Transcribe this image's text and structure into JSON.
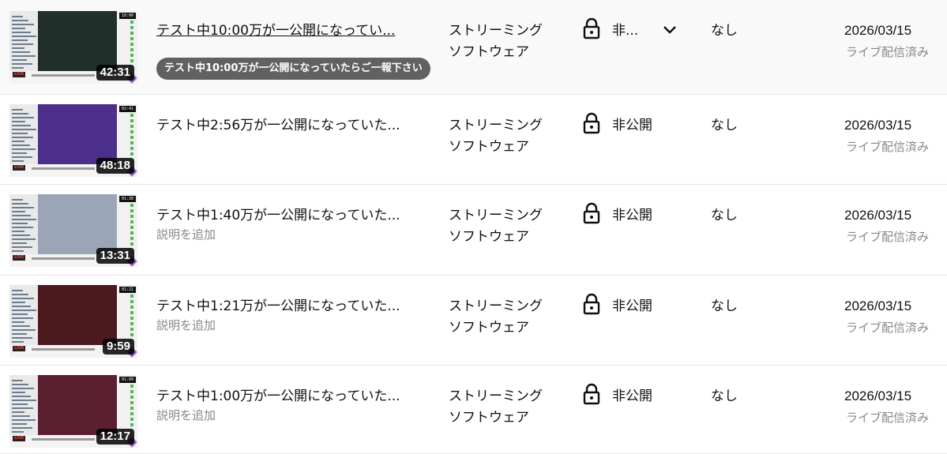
{
  "colors": {
    "row_hover_bg": "#f9f9f9",
    "secondary_text": "#888888",
    "tooltip_bg": "#616161"
  },
  "tooltip": {
    "text": "テスト中10:00万が一公開になっていたらご一報下さい"
  },
  "rows": [
    {
      "thumbnail": {
        "duration": "42:31",
        "top_badge": "10:00",
        "live_tag": "LIVE",
        "scene_color": "#22302c"
      },
      "title": "テスト中10:00万が一公開になってい...",
      "description": "",
      "type_line1": "ストリーミング",
      "type_line2": "ソフトウェア",
      "visibility": "非...",
      "visibility_icon": "lock-icon",
      "restrictions": "なし",
      "date": "2026/03/15",
      "date_status": "ライブ配信済み",
      "hovered": true
    },
    {
      "thumbnail": {
        "duration": "48:18",
        "top_badge": "02:41",
        "live_tag": "LIVE",
        "scene_color": "#4b2f8a"
      },
      "title": "テスト中2:56万が一公開になっていた...",
      "description": "",
      "type_line1": "ストリーミング",
      "type_line2": "ソフトウェア",
      "visibility": "非公開",
      "visibility_icon": "lock-icon",
      "restrictions": "なし",
      "date": "2026/03/15",
      "date_status": "ライブ配信済み",
      "hovered": false
    },
    {
      "thumbnail": {
        "duration": "13:31",
        "top_badge": "01:30",
        "live_tag": "LIVE",
        "scene_color": "#9aa6b8"
      },
      "title": "テスト中1:40万が一公開になっていた...",
      "description": "説明を追加",
      "type_line1": "ストリーミング",
      "type_line2": "ソフトウェア",
      "visibility": "非公開",
      "visibility_icon": "lock-icon",
      "restrictions": "なし",
      "date": "2026/03/15",
      "date_status": "ライブ配信済み",
      "hovered": false
    },
    {
      "thumbnail": {
        "duration": "9:59",
        "top_badge": "01:21",
        "live_tag": "LIVE",
        "scene_color": "#4a1a1e"
      },
      "title": "テスト中1:21万が一公開になっていた...",
      "description": "説明を追加",
      "type_line1": "ストリーミング",
      "type_line2": "ソフトウェア",
      "visibility": "非公開",
      "visibility_icon": "lock-icon",
      "restrictions": "なし",
      "date": "2026/03/15",
      "date_status": "ライブ配信済み",
      "hovered": false
    },
    {
      "thumbnail": {
        "duration": "12:17",
        "top_badge": "01:00",
        "live_tag": "LIVE",
        "scene_color": "#5a2030"
      },
      "title": "テスト中1:00万が一公開になっていた...",
      "description": "説明を追加",
      "type_line1": "ストリーミング",
      "type_line2": "ソフトウェア",
      "visibility": "非公開",
      "visibility_icon": "lock-icon",
      "restrictions": "なし",
      "date": "2026/03/15",
      "date_status": "ライブ配信済み",
      "hovered": false
    }
  ]
}
